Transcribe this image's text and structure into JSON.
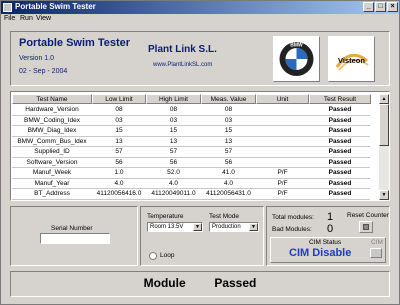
{
  "window": {
    "title": "Portable Swim Tester"
  },
  "menu": {
    "items": [
      "File",
      "Run",
      "View"
    ]
  },
  "header": {
    "product": "Portable Swim Tester",
    "version": "Version 1.0",
    "date": "02 - Sep - 2004",
    "company": "Plant Link S.L.",
    "website": "www.PlantLinkSL.com",
    "logo_left": "BMW",
    "logo_right": "Visteon"
  },
  "table": {
    "columns": [
      "Test Name",
      "Low Limit",
      "High Limit",
      "Meas. Value",
      "Unit",
      "Test Result"
    ],
    "rows": [
      [
        "Hardware_Version",
        "08",
        "08",
        "08",
        "",
        "Passed"
      ],
      [
        "BMW_Coding_Idex",
        "03",
        "03",
        "03",
        "",
        "Passed"
      ],
      [
        "BMW_Diag_Idex",
        "15",
        "15",
        "15",
        "",
        "Passed"
      ],
      [
        "BMW_Comm_Bus_Idex",
        "13",
        "13",
        "13",
        "",
        "Passed"
      ],
      [
        "Supplied_ID",
        "57",
        "57",
        "57",
        "",
        "Passed"
      ],
      [
        "Software_Version",
        "56",
        "56",
        "56",
        "",
        "Passed"
      ],
      [
        "Manuf_Week",
        "1.0",
        "52.0",
        "41.0",
        "P/F",
        "Passed"
      ],
      [
        "Manuf_Year",
        "4.0",
        "4.0",
        "4.0",
        "P/F",
        "Passed"
      ],
      [
        "BT_Address",
        "41120056416.0",
        "41120049011.0",
        "41120056431.0",
        "P/F",
        "Passed"
      ]
    ]
  },
  "serial": {
    "label": "Serial Number",
    "value": ""
  },
  "config": {
    "temperature_label": "Temperature",
    "temperature_value": "Room 13.5V",
    "test_mode_label": "Test Mode",
    "test_mode_value": "Production",
    "loop_label": "Loop"
  },
  "counters": {
    "total_label": "Total modules:",
    "total_value": "1",
    "bad_label": "Bad Modules:",
    "bad_value": "0",
    "reset_label": "Reset Counter",
    "cim_status_label": "CIM Status",
    "cim_status_value": "CIM Disable",
    "cim_label": "CIM"
  },
  "status": {
    "module": "Module",
    "result": "Passed"
  },
  "colors": {
    "title_blue": "#0a1e6e",
    "cim_blue": "#1e3cc8"
  }
}
